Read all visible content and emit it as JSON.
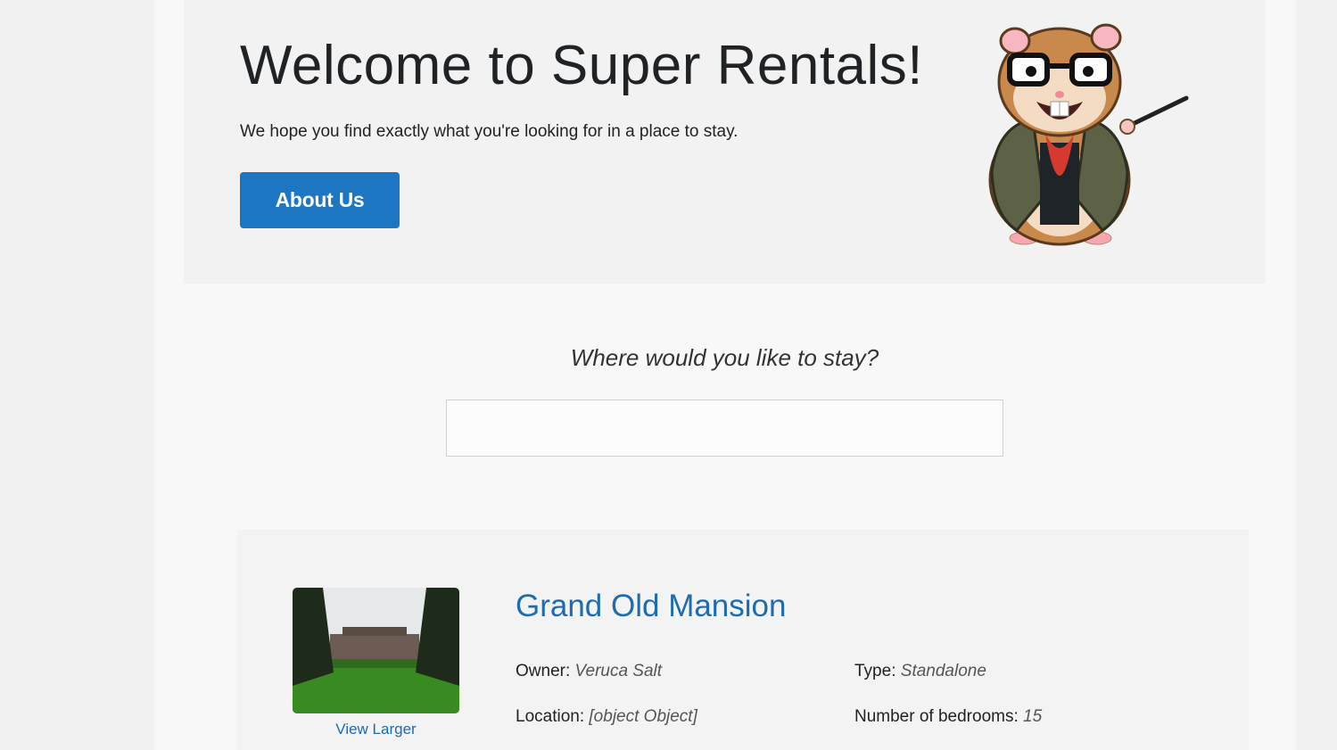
{
  "jumbo": {
    "title": "Welcome to Super Rentals!",
    "subtitle": "We hope you find exactly what you're looking for in a place to stay.",
    "about_button": "About Us"
  },
  "search": {
    "label": "Where would you like to stay?",
    "value": "",
    "placeholder": ""
  },
  "rental": {
    "title": "Grand Old Mansion",
    "view_larger": "View Larger",
    "owner_label": "Owner:",
    "owner": "Veruca Salt",
    "type_label": "Type:",
    "type": "Standalone",
    "location_label": "Location:",
    "location": "[object Object]",
    "bedrooms_label": "Number of bedrooms:",
    "bedrooms": "15"
  },
  "colors": {
    "accent": "#1d76c2",
    "link": "#1d6bb0"
  },
  "icons": {
    "mascot": "hamster-teacher-mascot",
    "thumbnail": "mansion-photo"
  }
}
